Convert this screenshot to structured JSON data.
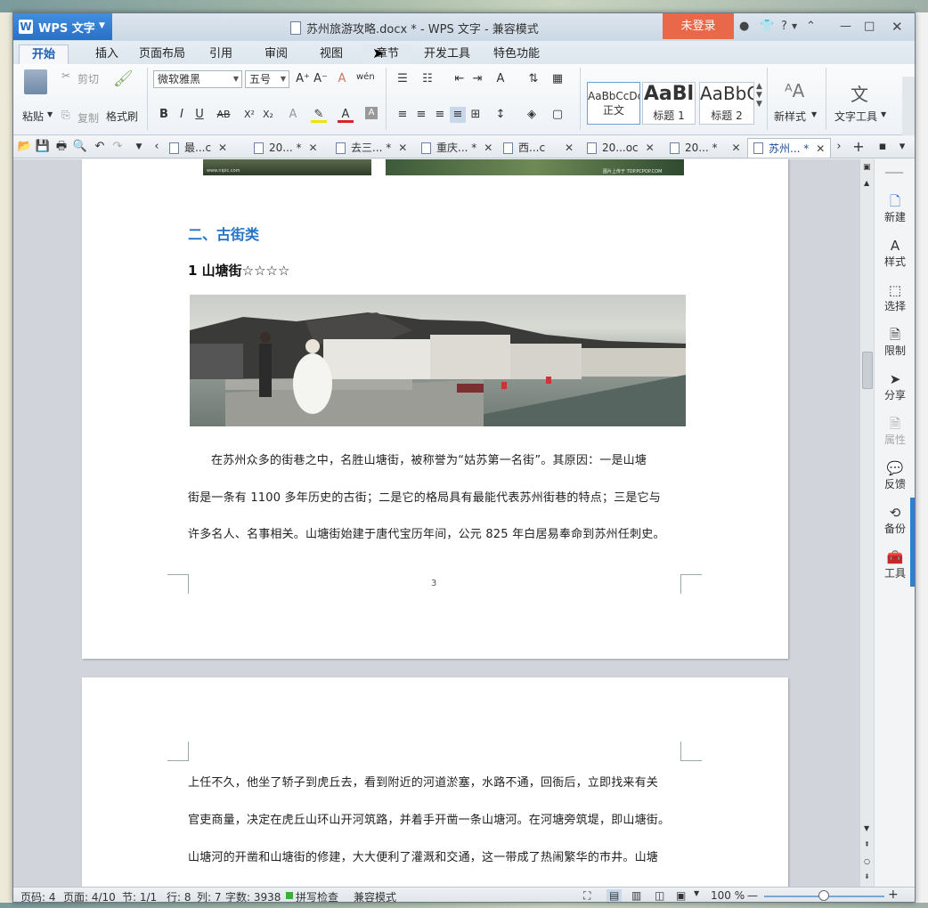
{
  "window": {
    "app_button": "WPS 文字",
    "title": "苏州旅游攻略.docx * - WPS 文字 - 兼容模式",
    "login": "未登录",
    "help": "?"
  },
  "menu": {
    "tabs": [
      "开始",
      "插入",
      "页面布局",
      "引用",
      "审阅",
      "视图",
      "章节",
      "开发工具",
      "特色功能"
    ],
    "active": "开始"
  },
  "ribbon": {
    "paste": "粘贴",
    "cut": "剪切",
    "copy": "复制",
    "format_painter": "格式刷",
    "font_name": "微软雅黑",
    "font_size": "五号",
    "styles": [
      {
        "sample": "AaBbCcDd",
        "label": "正文"
      },
      {
        "sample": "AaBl",
        "label": "标题 1"
      },
      {
        "sample": "AaBbC",
        "label": "标题 2"
      }
    ],
    "new_style": "新样式",
    "text_tools": "文字工具"
  },
  "doc_tabs": [
    "最...c",
    "20... *",
    "去三... *",
    "重庆... *",
    "西...c",
    "20...oc",
    "20... *",
    "苏州... *"
  ],
  "document": {
    "heading": "二、古街类",
    "subheading": "1 山塘街☆☆☆☆",
    "paragraph_lines": [
      "在苏州众多的街巷之中，名胜山塘街，被称誉为“姑苏第一名街”。其原因：一是山塘",
      "街是一条有 1100 多年历史的古街；二是它的格局具有最能代表苏州街巷的特点；三是它与",
      "许多名人、名事相关。山塘街始建于唐代宝历年间，公元 825 年白居易奉命到苏州任刺史。"
    ],
    "page_number": "3",
    "page2_lines": [
      "上任不久，他坐了轿子到虎丘去，看到附近的河道淤塞，水路不通，回衙后，立即找来有关",
      "官吏商量，决定在虎丘山环山开河筑路，并着手开凿一条山塘河。在河塘旁筑堤，即山塘街。",
      "山塘河的开凿和山塘街的修建，大大便利了灌溉和交通，这一带成了热闹繁华的市井。山塘"
    ],
    "top_image_caption_left": "www.nipic.com",
    "top_image_caption_right": "图片上传于 TOP.PCPOP.COM"
  },
  "sidepanel": [
    "新建",
    "样式",
    "选择",
    "限制",
    "分享",
    "属性",
    "反馈",
    "备份",
    "工具"
  ],
  "status": {
    "page_code": "页码: 4",
    "pages": "页面: 4/10",
    "section": "节: 1/1",
    "row": "行: 8",
    "col": "列: 7",
    "words": "字数: 3938",
    "spell": "拼写检查",
    "compat": "兼容模式",
    "zoom": "100 %"
  }
}
